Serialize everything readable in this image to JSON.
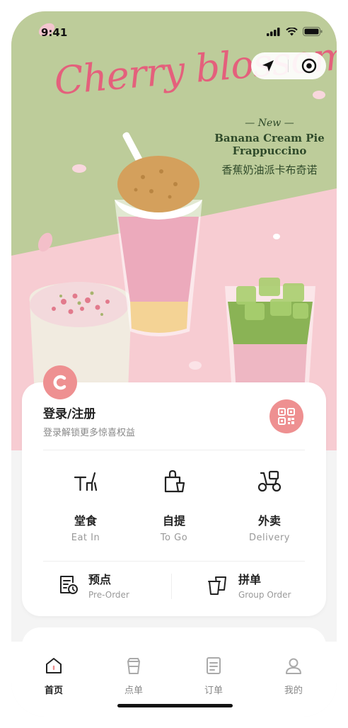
{
  "status_bar": {
    "time": "9:41"
  },
  "banner": {
    "script_title": "Cherry blossoms",
    "tag": "— New —",
    "product_en_line1": "Banana Cream Pie",
    "product_en_line2": "Frappuccino",
    "product_cn": "香蕉奶油派卡布奇诺"
  },
  "member": {
    "title": "登录/注册",
    "subtitle": "登录解锁更多惊喜权益",
    "qr_icon": "qr-code-icon"
  },
  "services": [
    {
      "title": "堂食",
      "subtitle": "Eat In",
      "icon": "dine-in-icon"
    },
    {
      "title": "自提",
      "subtitle": "To Go",
      "icon": "takeaway-bag-icon"
    },
    {
      "title": "外卖",
      "subtitle": "Delivery",
      "icon": "scooter-icon"
    }
  ],
  "secondary": [
    {
      "title": "预点",
      "subtitle": "Pre-Order",
      "icon": "pre-order-icon"
    },
    {
      "title": "拼单",
      "subtitle": "Group Order",
      "icon": "group-order-icon"
    }
  ],
  "tabs": [
    {
      "label": "首页",
      "icon": "home-icon",
      "active": true
    },
    {
      "label": "点单",
      "icon": "cup-icon",
      "active": false
    },
    {
      "label": "订单",
      "icon": "order-list-icon",
      "active": false
    },
    {
      "label": "我的",
      "icon": "profile-icon",
      "active": false
    }
  ],
  "colors": {
    "accent": "#ee9091",
    "banner_green": "#bdcc9a",
    "banner_pink": "#f7ccd2",
    "script_pink": "#e4607c"
  }
}
